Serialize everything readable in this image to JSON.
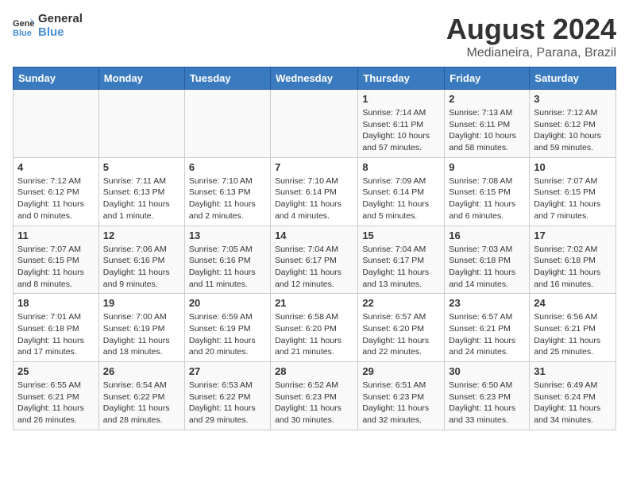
{
  "logo": {
    "text_general": "General",
    "text_blue": "Blue"
  },
  "title": "August 2024",
  "subtitle": "Medianeira, Parana, Brazil",
  "weekdays": [
    "Sunday",
    "Monday",
    "Tuesday",
    "Wednesday",
    "Thursday",
    "Friday",
    "Saturday"
  ],
  "weeks": [
    [
      {
        "day": "",
        "info": ""
      },
      {
        "day": "",
        "info": ""
      },
      {
        "day": "",
        "info": ""
      },
      {
        "day": "",
        "info": ""
      },
      {
        "day": "1",
        "info": "Sunrise: 7:14 AM\nSunset: 6:11 PM\nDaylight: 10 hours\nand 57 minutes."
      },
      {
        "day": "2",
        "info": "Sunrise: 7:13 AM\nSunset: 6:11 PM\nDaylight: 10 hours\nand 58 minutes."
      },
      {
        "day": "3",
        "info": "Sunrise: 7:12 AM\nSunset: 6:12 PM\nDaylight: 10 hours\nand 59 minutes."
      }
    ],
    [
      {
        "day": "4",
        "info": "Sunrise: 7:12 AM\nSunset: 6:12 PM\nDaylight: 11 hours\nand 0 minutes."
      },
      {
        "day": "5",
        "info": "Sunrise: 7:11 AM\nSunset: 6:13 PM\nDaylight: 11 hours\nand 1 minute."
      },
      {
        "day": "6",
        "info": "Sunrise: 7:10 AM\nSunset: 6:13 PM\nDaylight: 11 hours\nand 2 minutes."
      },
      {
        "day": "7",
        "info": "Sunrise: 7:10 AM\nSunset: 6:14 PM\nDaylight: 11 hours\nand 4 minutes."
      },
      {
        "day": "8",
        "info": "Sunrise: 7:09 AM\nSunset: 6:14 PM\nDaylight: 11 hours\nand 5 minutes."
      },
      {
        "day": "9",
        "info": "Sunrise: 7:08 AM\nSunset: 6:15 PM\nDaylight: 11 hours\nand 6 minutes."
      },
      {
        "day": "10",
        "info": "Sunrise: 7:07 AM\nSunset: 6:15 PM\nDaylight: 11 hours\nand 7 minutes."
      }
    ],
    [
      {
        "day": "11",
        "info": "Sunrise: 7:07 AM\nSunset: 6:15 PM\nDaylight: 11 hours\nand 8 minutes."
      },
      {
        "day": "12",
        "info": "Sunrise: 7:06 AM\nSunset: 6:16 PM\nDaylight: 11 hours\nand 9 minutes."
      },
      {
        "day": "13",
        "info": "Sunrise: 7:05 AM\nSunset: 6:16 PM\nDaylight: 11 hours\nand 11 minutes."
      },
      {
        "day": "14",
        "info": "Sunrise: 7:04 AM\nSunset: 6:17 PM\nDaylight: 11 hours\nand 12 minutes."
      },
      {
        "day": "15",
        "info": "Sunrise: 7:04 AM\nSunset: 6:17 PM\nDaylight: 11 hours\nand 13 minutes."
      },
      {
        "day": "16",
        "info": "Sunrise: 7:03 AM\nSunset: 6:18 PM\nDaylight: 11 hours\nand 14 minutes."
      },
      {
        "day": "17",
        "info": "Sunrise: 7:02 AM\nSunset: 6:18 PM\nDaylight: 11 hours\nand 16 minutes."
      }
    ],
    [
      {
        "day": "18",
        "info": "Sunrise: 7:01 AM\nSunset: 6:18 PM\nDaylight: 11 hours\nand 17 minutes."
      },
      {
        "day": "19",
        "info": "Sunrise: 7:00 AM\nSunset: 6:19 PM\nDaylight: 11 hours\nand 18 minutes."
      },
      {
        "day": "20",
        "info": "Sunrise: 6:59 AM\nSunset: 6:19 PM\nDaylight: 11 hours\nand 20 minutes."
      },
      {
        "day": "21",
        "info": "Sunrise: 6:58 AM\nSunset: 6:20 PM\nDaylight: 11 hours\nand 21 minutes."
      },
      {
        "day": "22",
        "info": "Sunrise: 6:57 AM\nSunset: 6:20 PM\nDaylight: 11 hours\nand 22 minutes."
      },
      {
        "day": "23",
        "info": "Sunrise: 6:57 AM\nSunset: 6:21 PM\nDaylight: 11 hours\nand 24 minutes."
      },
      {
        "day": "24",
        "info": "Sunrise: 6:56 AM\nSunset: 6:21 PM\nDaylight: 11 hours\nand 25 minutes."
      }
    ],
    [
      {
        "day": "25",
        "info": "Sunrise: 6:55 AM\nSunset: 6:21 PM\nDaylight: 11 hours\nand 26 minutes."
      },
      {
        "day": "26",
        "info": "Sunrise: 6:54 AM\nSunset: 6:22 PM\nDaylight: 11 hours\nand 28 minutes."
      },
      {
        "day": "27",
        "info": "Sunrise: 6:53 AM\nSunset: 6:22 PM\nDaylight: 11 hours\nand 29 minutes."
      },
      {
        "day": "28",
        "info": "Sunrise: 6:52 AM\nSunset: 6:23 PM\nDaylight: 11 hours\nand 30 minutes."
      },
      {
        "day": "29",
        "info": "Sunrise: 6:51 AM\nSunset: 6:23 PM\nDaylight: 11 hours\nand 32 minutes."
      },
      {
        "day": "30",
        "info": "Sunrise: 6:50 AM\nSunset: 6:23 PM\nDaylight: 11 hours\nand 33 minutes."
      },
      {
        "day": "31",
        "info": "Sunrise: 6:49 AM\nSunset: 6:24 PM\nDaylight: 11 hours\nand 34 minutes."
      }
    ]
  ]
}
